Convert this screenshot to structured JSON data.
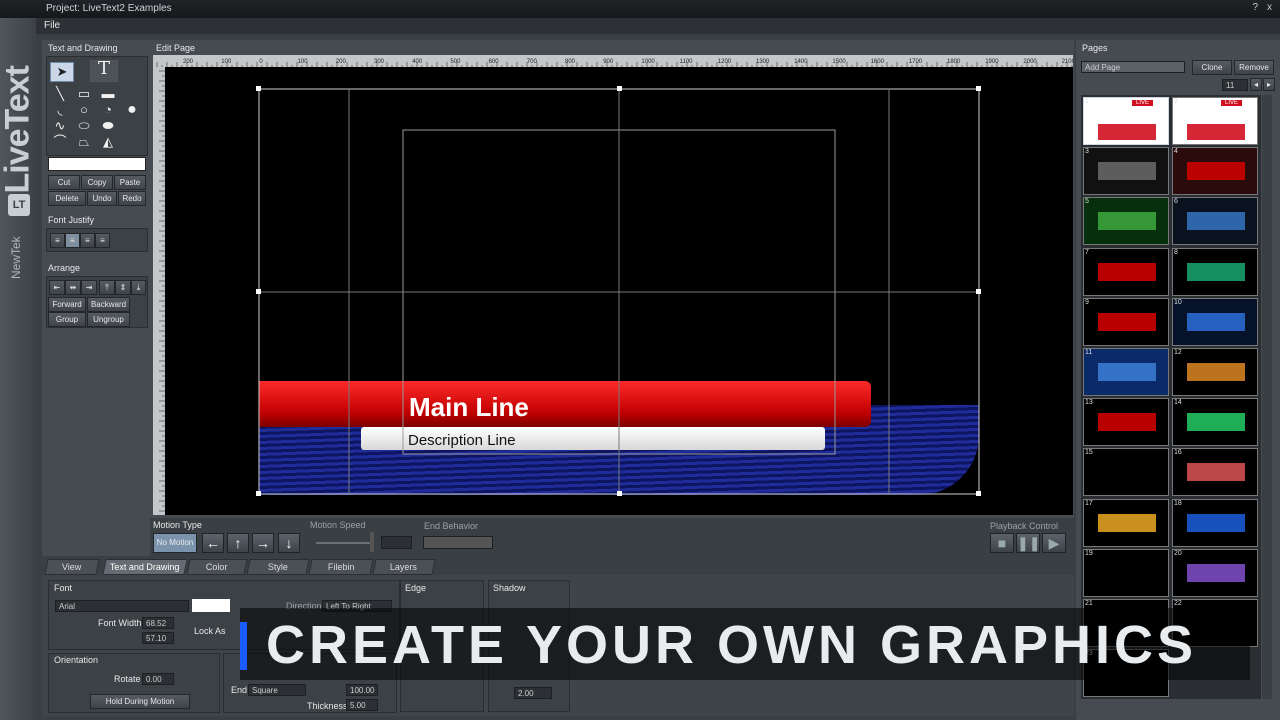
{
  "window": {
    "title": "Project: LiveText2 Examples",
    "help_glyph": "?",
    "close_glyph": "x"
  },
  "menu": {
    "file": "File"
  },
  "brand": {
    "product": "LiveText",
    "logo": "LT",
    "company": "NewTek"
  },
  "left": {
    "section_title": "Text and Drawing",
    "edit_buttons": [
      "Cut",
      "Copy",
      "Paste",
      "Delete",
      "Undo",
      "Redo"
    ],
    "font_justify_title": "Font Justify",
    "arrange_title": "Arrange",
    "arrange_buttons": [
      "Forward",
      "Backward",
      "Group",
      "Ungroup"
    ]
  },
  "edit_page": {
    "title": "Edit Page",
    "ruler_ticks": [
      "200",
      "100",
      "0",
      "100",
      "200",
      "300",
      "400",
      "500",
      "600",
      "700",
      "800",
      "900",
      "1000",
      "1100",
      "1200",
      "1300",
      "1400",
      "1500",
      "1600",
      "1700",
      "1800",
      "1900",
      "2000",
      "2100"
    ],
    "main_line": "Main Line",
    "description_line": "Description Line"
  },
  "motion": {
    "motion_type_label": "Motion Type",
    "motion_value": "No Motion",
    "motion_speed_label": "Motion Speed",
    "end_behavior_label": "End Behavior",
    "playback_label": "Playback Control"
  },
  "tabs": [
    "View",
    "Text and Drawing",
    "Color",
    "Style",
    "Filebin",
    "Layers"
  ],
  "active_tab": "Text and Drawing",
  "font_panel": {
    "font_label": "Font",
    "font_value": "Arial",
    "direction_label": "Direction",
    "direction_value": "Left To Right",
    "font_width_label": "Font Width",
    "font_width_value": "68.52",
    "font_height_value": "57.10",
    "lock_label": "Lock As",
    "edge_label": "Edge",
    "shadow_label": "Shadow",
    "orientation_label": "Orientation",
    "rotate_label": "Rotate",
    "rotate_value": "0.00",
    "hold_label": "Hold During Motion",
    "end_label": "End",
    "end_value": "Square",
    "start_value": "100.00",
    "thickness_label": "Thickness",
    "thickness_value": "5.00",
    "shadow_value": "2.00"
  },
  "pages": {
    "title": "Pages",
    "add_page": "Add Page",
    "clone": "Clone",
    "remove": "Remove",
    "page_count": "11",
    "thumbs": [
      "1",
      "2",
      "3",
      "4",
      "5",
      "6",
      "7",
      "8",
      "9",
      "10",
      "11",
      "12",
      "13",
      "14",
      "15",
      "16",
      "17",
      "18",
      "19",
      "20",
      "21",
      "22",
      "23"
    ],
    "live_badge": "LIVE"
  },
  "overlay": {
    "caption": "CREATE YOUR OWN GRAPHICS"
  },
  "colors": {
    "accent": "#1b5cff",
    "bar_red": "#e00000",
    "bar_blue": "#1a2590"
  }
}
